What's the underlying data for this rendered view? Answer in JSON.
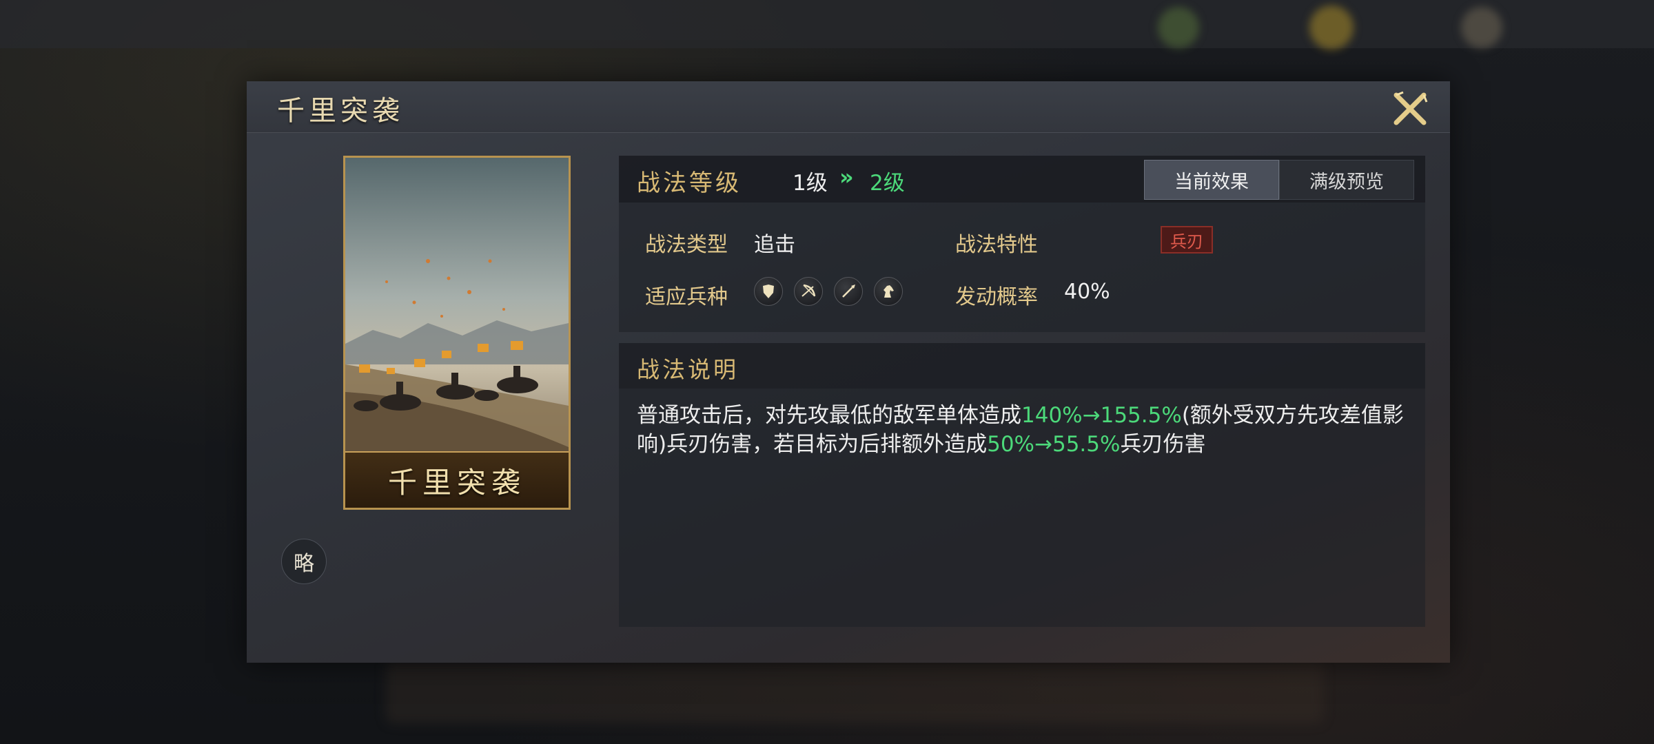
{
  "modal": {
    "title": "千里突袭"
  },
  "card": {
    "name": "千里突袭"
  },
  "strategy_button": "略",
  "level": {
    "label": "战法等级",
    "from": "1级",
    "arrow": "»",
    "to": "2级"
  },
  "tabs": {
    "current": "当前效果",
    "max": "满级预览"
  },
  "attributes": {
    "type_label": "战法类型",
    "type_value": "追击",
    "trait_label": "战法特性",
    "trait_value": "兵刃",
    "troops_label": "适应兵种",
    "troops": [
      "shield-icon",
      "bow-icon",
      "spear-icon",
      "horse-icon"
    ],
    "rate_label": "发动概率",
    "rate_value": "40%"
  },
  "description": {
    "title": "战法说明",
    "part1": "普通攻击后，对先攻最低的敌军单体造成",
    "value1": "140%→155.5%",
    "part2": "(额外受双方先攻差值影响)兵刃伤害，若目标为后排额外造成",
    "value2": "50%→55.5%",
    "part3": "兵刃伤害"
  },
  "colors": {
    "accent_gold": "#d8b974",
    "highlight_green": "#4cd97a",
    "trait_red": "#e05a4c"
  }
}
